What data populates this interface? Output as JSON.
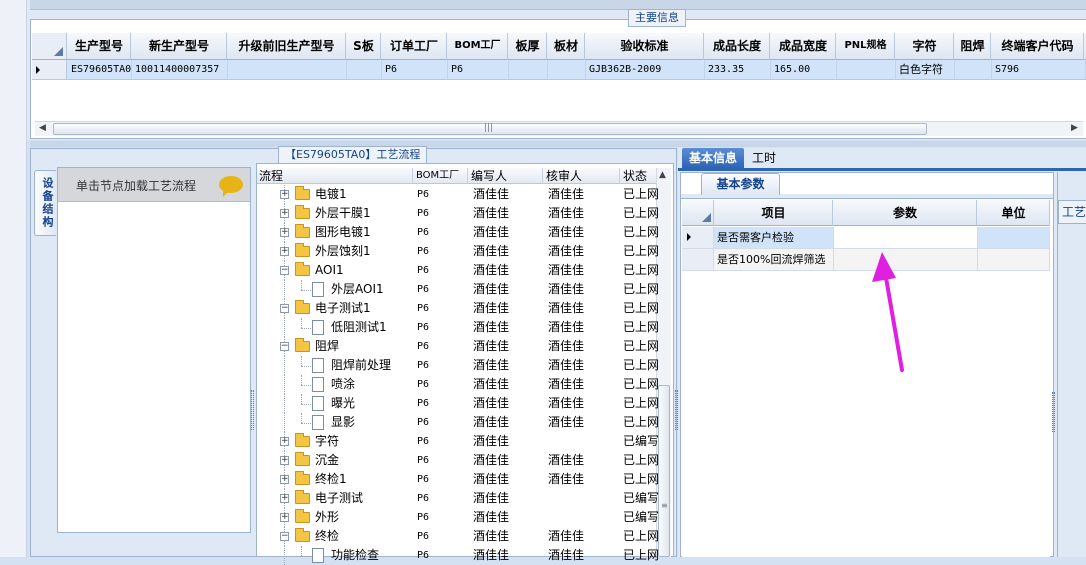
{
  "main_info": {
    "legend": "主要信息",
    "columns": [
      "生产型号",
      "新生产型号",
      "升级前旧生产型号",
      "S板",
      "订单工厂",
      "BOM工厂",
      "板厚",
      "板材",
      "验收标准",
      "成品长度",
      "成品宽度",
      "PNL规格",
      "字符",
      "阻焊",
      "终端客户代码"
    ],
    "row": {
      "model": "ES79605TA0",
      "new_model": "10011400007357",
      "old_model": "",
      "s_board": "",
      "order_factory": "P6",
      "bom_factory": "P6",
      "thickness": "",
      "material": "",
      "standard": "GJB362B-2009",
      "length": "233.35",
      "width": "165.00",
      "pnl": "",
      "char": "白色字符",
      "solder_mask": "",
      "customer_code": "S796"
    },
    "scroll_grip": "|||"
  },
  "left_panel": {
    "side_tab": "设备结构",
    "load_hint": "单击节点加载工艺流程"
  },
  "process": {
    "legend": "【ES79605TA0】工艺流程",
    "columns": [
      "流程",
      "BOM工厂",
      "编写人",
      "核审人",
      "状态"
    ],
    "rows": [
      {
        "name": "电镀1",
        "type": "folder",
        "level": 0,
        "bom": "P6",
        "writer": "酒佳佳",
        "reviewer": "酒佳佳",
        "status": "已上网"
      },
      {
        "name": "外层干膜1",
        "type": "folder",
        "level": 0,
        "bom": "P6",
        "writer": "酒佳佳",
        "reviewer": "酒佳佳",
        "status": "已上网"
      },
      {
        "name": "图形电镀1",
        "type": "folder",
        "level": 0,
        "bom": "P6",
        "writer": "酒佳佳",
        "reviewer": "酒佳佳",
        "status": "已上网"
      },
      {
        "name": "外层蚀刻1",
        "type": "folder",
        "level": 0,
        "bom": "P6",
        "writer": "酒佳佳",
        "reviewer": "酒佳佳",
        "status": "已上网"
      },
      {
        "name": "AOI1",
        "type": "folder",
        "level": 0,
        "expanded": true,
        "bom": "P6",
        "writer": "酒佳佳",
        "reviewer": "酒佳佳",
        "status": "已上网"
      },
      {
        "name": "外层AOI1",
        "type": "doc",
        "level": 1,
        "bom": "P6",
        "writer": "酒佳佳",
        "reviewer": "酒佳佳",
        "status": "已上网"
      },
      {
        "name": "电子测试1",
        "type": "folder",
        "level": 0,
        "expanded": true,
        "bom": "P6",
        "writer": "酒佳佳",
        "reviewer": "酒佳佳",
        "status": "已上网"
      },
      {
        "name": "低阻测试1",
        "type": "doc",
        "level": 1,
        "bom": "P6",
        "writer": "酒佳佳",
        "reviewer": "酒佳佳",
        "status": "已上网"
      },
      {
        "name": "阻焊",
        "type": "folder",
        "level": 0,
        "expanded": true,
        "bom": "P6",
        "writer": "酒佳佳",
        "reviewer": "酒佳佳",
        "status": "已上网"
      },
      {
        "name": "阻焊前处理",
        "type": "doc",
        "level": 1,
        "bom": "P6",
        "writer": "酒佳佳",
        "reviewer": "酒佳佳",
        "status": "已上网"
      },
      {
        "name": "喷涂",
        "type": "doc",
        "level": 1,
        "bom": "P6",
        "writer": "酒佳佳",
        "reviewer": "酒佳佳",
        "status": "已上网"
      },
      {
        "name": "曝光",
        "type": "doc",
        "level": 1,
        "bom": "P6",
        "writer": "酒佳佳",
        "reviewer": "酒佳佳",
        "status": "已上网"
      },
      {
        "name": "显影",
        "type": "doc",
        "level": 1,
        "bom": "P6",
        "writer": "酒佳佳",
        "reviewer": "酒佳佳",
        "status": "已上网"
      },
      {
        "name": "字符",
        "type": "folder",
        "level": 0,
        "bom": "P6",
        "writer": "酒佳佳",
        "reviewer": "",
        "status": "已编写"
      },
      {
        "name": "沉金",
        "type": "folder",
        "level": 0,
        "bom": "P6",
        "writer": "酒佳佳",
        "reviewer": "酒佳佳",
        "status": "已上网"
      },
      {
        "name": "终检1",
        "type": "folder",
        "level": 0,
        "bom": "P6",
        "writer": "酒佳佳",
        "reviewer": "酒佳佳",
        "status": "已上网"
      },
      {
        "name": "电子测试",
        "type": "folder",
        "level": 0,
        "bom": "P6",
        "writer": "酒佳佳",
        "reviewer": "",
        "status": "已编写"
      },
      {
        "name": "外形",
        "type": "folder",
        "level": 0,
        "bom": "P6",
        "writer": "酒佳佳",
        "reviewer": "",
        "status": "已编写"
      },
      {
        "name": "终检",
        "type": "folder",
        "level": 0,
        "expanded": true,
        "bom": "P6",
        "writer": "酒佳佳",
        "reviewer": "酒佳佳",
        "status": "已上网"
      },
      {
        "name": "功能检查",
        "type": "doc",
        "level": 1,
        "bom": "P6",
        "writer": "酒佳佳",
        "reviewer": "酒佳佳",
        "status": "已上网"
      }
    ]
  },
  "right_panel": {
    "tabs": [
      "基本信息",
      "工时"
    ],
    "active_tab": "基本信息",
    "inner_tab": "基本参数",
    "side_tab": "工艺",
    "columns": [
      "项目",
      "参数",
      "单位"
    ],
    "rows": [
      {
        "item": "是否需客户检验",
        "param": "",
        "unit": ""
      },
      {
        "item": "是否100%回流焊筛选",
        "param": "",
        "unit": ""
      }
    ]
  },
  "colors": {
    "accent": "#2d65b5",
    "selected_row": "#d0e3f8",
    "annotation_arrow": "#e020e0"
  }
}
